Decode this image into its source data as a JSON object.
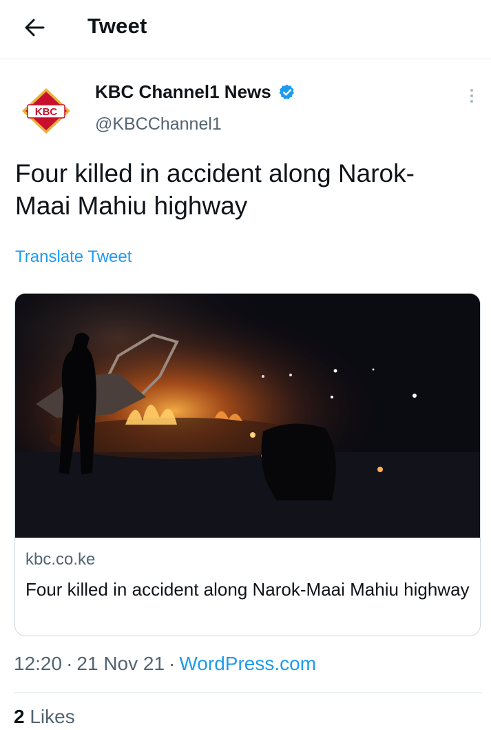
{
  "header": {
    "title": "Tweet",
    "back_icon": "arrow-left-icon"
  },
  "author": {
    "display_name": "KBC Channel1 News",
    "handle": "@KBCChannel1",
    "avatar_text": "KBC",
    "verified_icon": "verified-badge-icon",
    "more_icon": "more-vertical-icon",
    "colors": {
      "verified": "#1d9bf0",
      "logo_red": "#c8102e",
      "logo_gold": "#e8b13a"
    }
  },
  "tweet": {
    "text": "Four killed in accident along Narok-Maai Mahiu highway",
    "translate_label": "Translate Tweet"
  },
  "card": {
    "domain": "kbc.co.ke",
    "title": "Four killed in accident along Narok-Maai Mahiu highway"
  },
  "meta": {
    "time": "12:20",
    "date": "21 Nov 21",
    "source": "WordPress.com",
    "separator": "·"
  },
  "stats": {
    "likes_count": "2",
    "likes_label": "Likes"
  },
  "colors": {
    "link": "#1d9bf0",
    "secondary_text": "#536471",
    "primary_text": "#0f1419",
    "border": "#cfd9de"
  }
}
